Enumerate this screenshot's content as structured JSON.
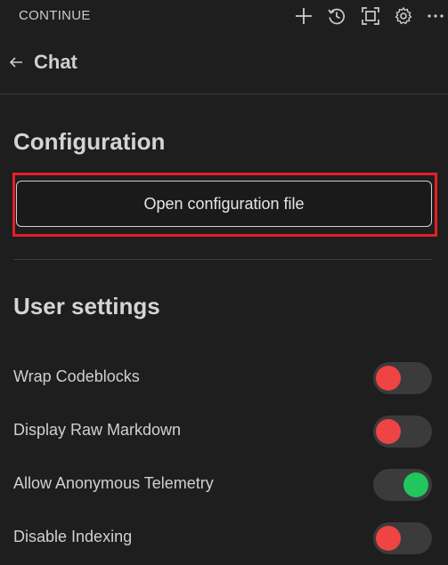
{
  "header": {
    "title": "CONTINUE",
    "icons": [
      "plus-icon",
      "history-icon",
      "fullscreen-icon",
      "gear-icon",
      "more-icon"
    ]
  },
  "chat": {
    "back_icon": "arrow-left-icon",
    "label": "Chat"
  },
  "configuration": {
    "heading": "Configuration",
    "open_button_label": "Open configuration file"
  },
  "user_settings": {
    "heading": "User settings",
    "items": [
      {
        "label": "Wrap Codeblocks",
        "enabled": false
      },
      {
        "label": "Display Raw Markdown",
        "enabled": false
      },
      {
        "label": "Allow Anonymous Telemetry",
        "enabled": true
      },
      {
        "label": "Disable Indexing",
        "enabled": false
      }
    ]
  },
  "colors": {
    "toggle_off_knob": "#ef4444",
    "toggle_on_knob": "#22c55e",
    "highlight_border": "#e0202a",
    "background": "#1e1e1e"
  }
}
